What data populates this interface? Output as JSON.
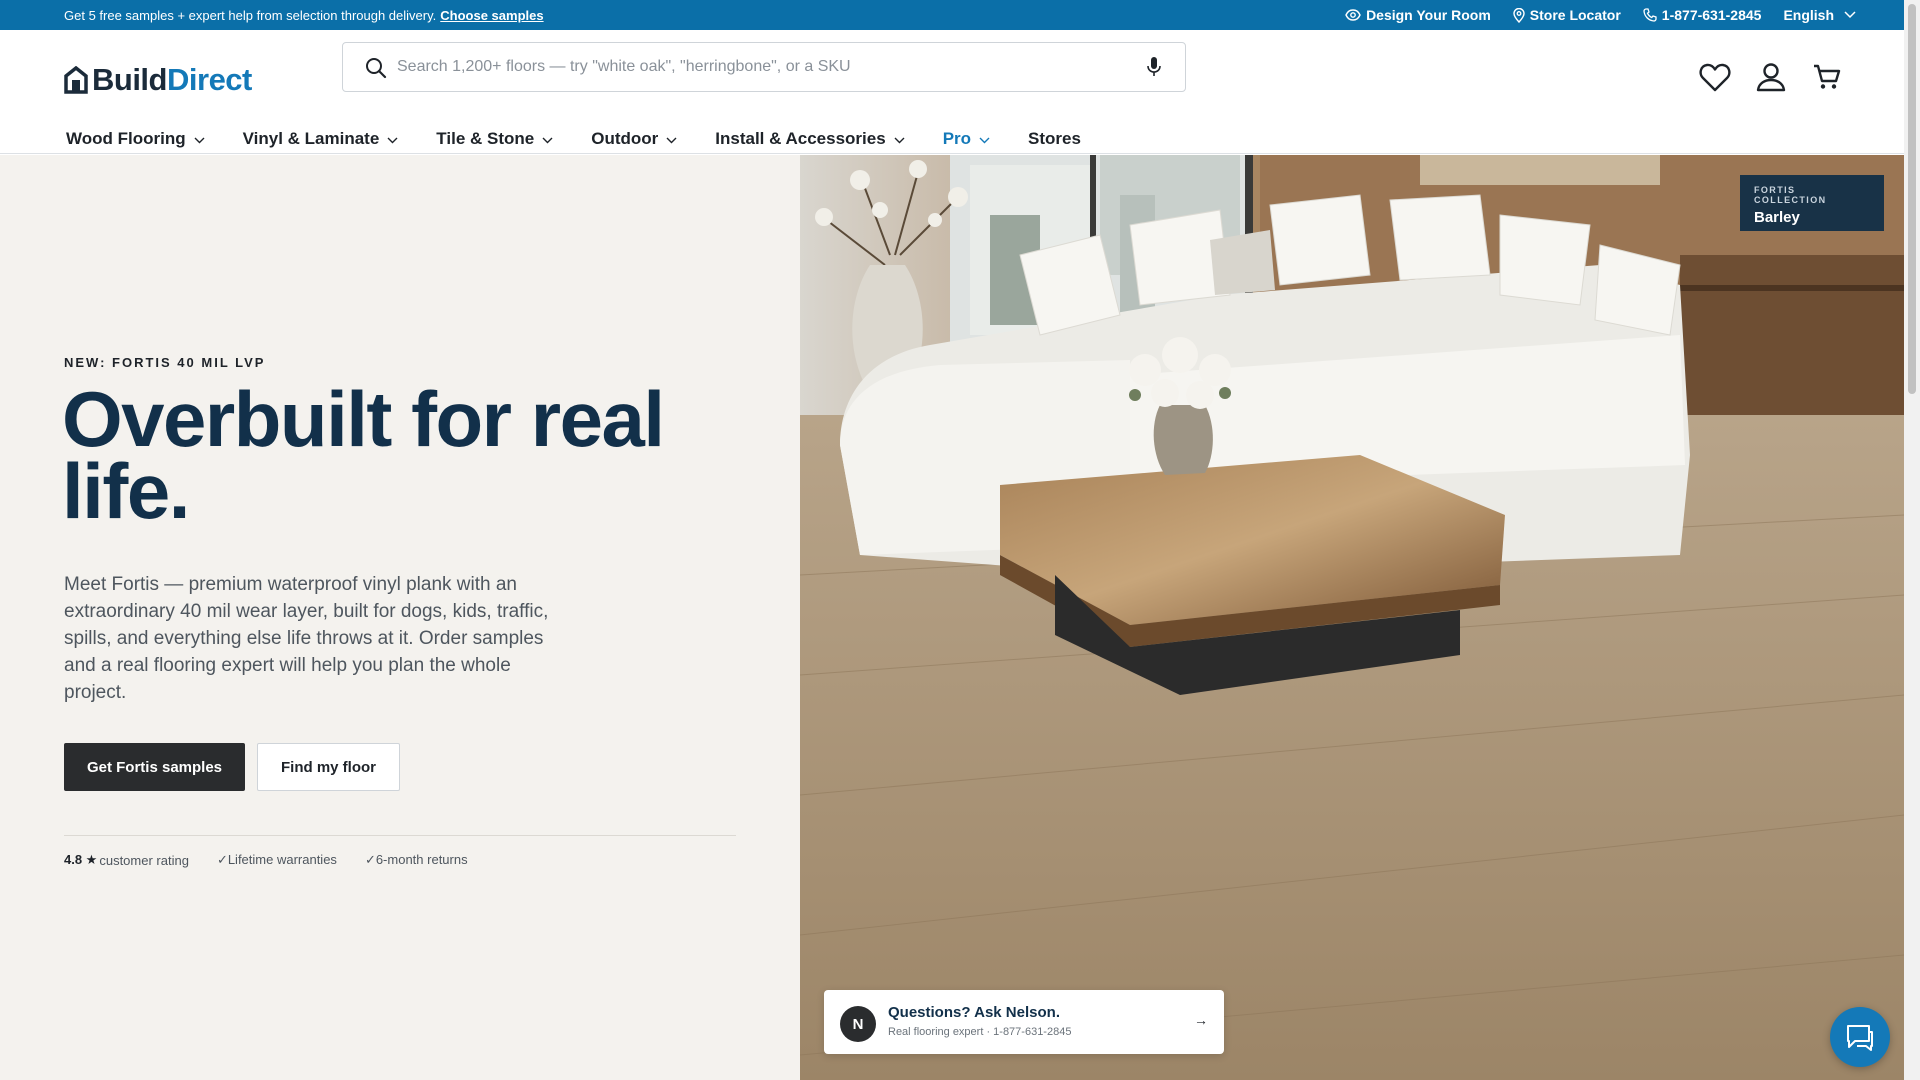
{
  "promo": {
    "text": "Get 5 free samples + expert help from selection through delivery.",
    "link": "Choose samples",
    "design_room": "Design Your Room",
    "store_locator": "Store Locator",
    "phone": "1-877-631-2845",
    "language": "English"
  },
  "brand": {
    "part1": "Build",
    "part2": "Direct"
  },
  "search": {
    "placeholder": "Search 1,200+ floors — try \"white oak\", \"herringbone\", or a SKU",
    "value": ""
  },
  "icons": {
    "wishlist": "heart-icon",
    "account": "user-icon",
    "cart": "cart-icon",
    "search": "search-icon",
    "mic": "microphone-icon",
    "chat": "chat-icon"
  },
  "nav": [
    {
      "label": "Wood Flooring",
      "dropdown": true
    },
    {
      "label": "Vinyl & Laminate",
      "dropdown": true
    },
    {
      "label": "Tile & Stone",
      "dropdown": true
    },
    {
      "label": "Outdoor",
      "dropdown": true
    },
    {
      "label": "Install & Accessories",
      "dropdown": true
    },
    {
      "label": "Pro",
      "dropdown": true
    },
    {
      "label": "Stores",
      "dropdown": false
    }
  ],
  "hero": {
    "eyebrow": "NEW: FORTIS 40 MIL LVP",
    "headline": "Overbuilt for real life.",
    "description": "Meet Fortis — premium waterproof vinyl plank with an extraordinary 40 mil wear layer, built for dogs, kids, traffic, spills, and everything else life throws at it. Order samples and a real flooring expert will help you plan the whole project.",
    "primary_button": "Get Fortis samples",
    "secondary_button": "Find my floor",
    "rating_value": "4.8 ★",
    "rating_label": "customer rating",
    "warranty": "✓Lifetime warranties",
    "returns": "✓6-month returns",
    "badge_kicker": "FORTIS COLLECTION",
    "badge_name": "Barley"
  },
  "nelson": {
    "avatar": "N",
    "question": "Questions? Ask Nelson.",
    "subtitle": "Real flooring expert · 1-877-631-2845",
    "arrow": "→"
  },
  "colors": {
    "brand_blue": "#1479b8",
    "promo_bar": "#0b6fa8",
    "headline": "#12304a",
    "primary_button": "#2a2c2e",
    "hero_bg": "#f4f2ee"
  }
}
